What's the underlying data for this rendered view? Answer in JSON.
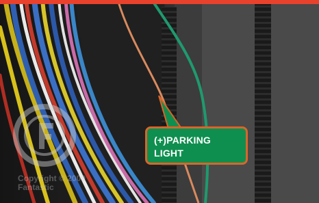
{
  "callout": {
    "line1": "(+)PARKING",
    "line2": "LIGHT"
  },
  "watermark": {
    "line1": "Copyright © 2009",
    "line2": "Fantastic"
  },
  "colors": {
    "top_banner": "#e8412c",
    "callout_fill": "#0f8f4f",
    "callout_border": "#d9662a",
    "callout_text": "#ffffff"
  },
  "icons": {
    "watermark_logo": "f-circle-logo-icon"
  }
}
